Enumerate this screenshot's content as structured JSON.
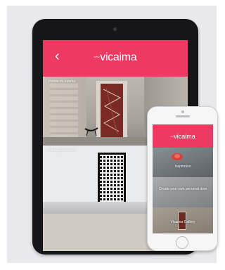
{
  "tablet": {
    "header": {
      "back_glyph": "‹",
      "logo_mark": "〰",
      "logo_text": "vicaima"
    },
    "cards": [
      {
        "label": "Portas de Interior"
      },
      {
        "label": "Portas Exteriores"
      },
      {
        "label": ""
      }
    ]
  },
  "phone": {
    "header": {
      "logo_mark": "〰",
      "logo_text": "vicaima"
    },
    "cards": [
      {
        "label": "Inspiration"
      },
      {
        "label": "Create your own personal door"
      },
      {
        "label": "Vicaima Gallery"
      }
    ]
  },
  "colors": {
    "brand": "#ee3a63",
    "device_dark": "#161618",
    "device_light": "#f6f6f7"
  }
}
